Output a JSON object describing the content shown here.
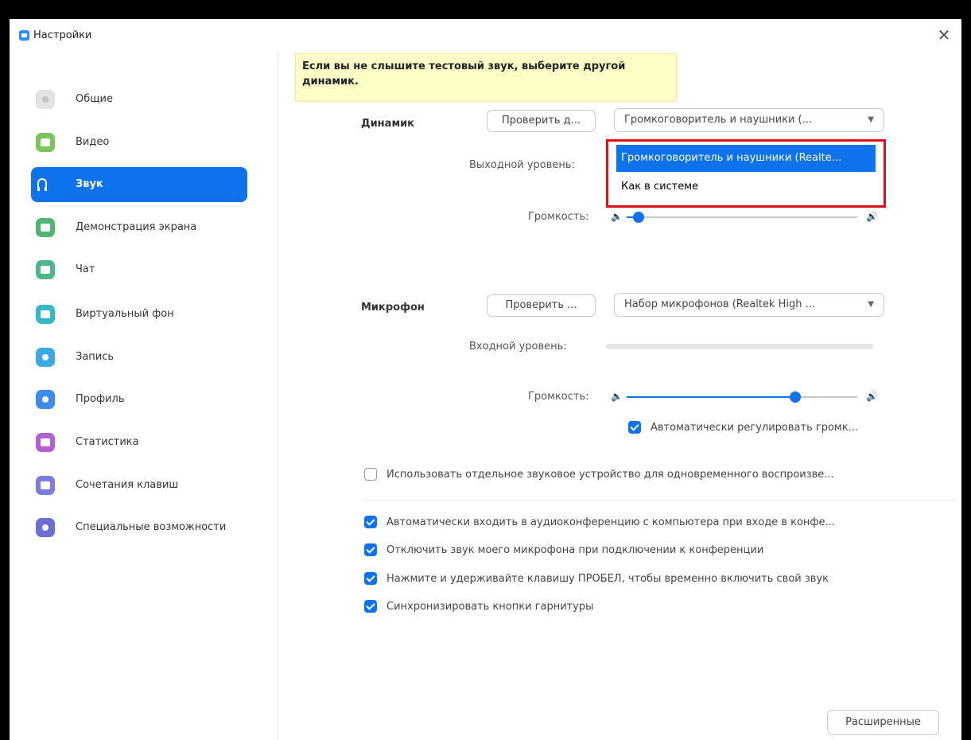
{
  "window": {
    "title": "Настройки"
  },
  "sidebar": {
    "items": [
      {
        "label": "Общие",
        "icon": "gear-icon",
        "color": "#d9d9d9",
        "active": false
      },
      {
        "label": "Видео",
        "icon": "video-camera-icon",
        "color": "#7cc35c",
        "active": false
      },
      {
        "label": "Звук",
        "icon": "headphones-icon",
        "color": "#0e72ed",
        "active": true
      },
      {
        "label": "Демонстрация экрана",
        "icon": "screen-share-icon",
        "color": "#4fb672",
        "active": false
      },
      {
        "label": "Чат",
        "icon": "chat-bubble-icon",
        "color": "#4fb68b",
        "active": false
      },
      {
        "label": "Виртуальный фон",
        "icon": "virtual-background-icon",
        "color": "#35b7c6",
        "active": false
      },
      {
        "label": "Запись",
        "icon": "record-icon",
        "color": "#3aa9e6",
        "active": false
      },
      {
        "label": "Профиль",
        "icon": "profile-icon",
        "color": "#3c8cf0",
        "active": false
      },
      {
        "label": "Статистика",
        "icon": "statistics-icon",
        "color": "#b260cf",
        "active": false
      },
      {
        "label": "Сочетания клавиш",
        "icon": "keyboard-icon",
        "color": "#7b7be0",
        "active": false
      },
      {
        "label": "Специальные возможности",
        "icon": "accessibility-icon",
        "color": "#6b6fd4",
        "active": false
      }
    ]
  },
  "notice": {
    "text": "Если вы не слышите тестовый звук, выберите другой динамик."
  },
  "speaker": {
    "label": "Динамик",
    "test_button": "Проверить д...",
    "selected": "Громкоговоритель и наушники (...",
    "options": [
      {
        "label": "Громкоговоритель и наушники (Realte...",
        "selected": true
      },
      {
        "label": "Как в системе",
        "selected": false
      }
    ],
    "output_level_label": "Выходной уровень:",
    "volume_label": "Громкость:",
    "volume": 0.05
  },
  "microphone": {
    "label": "Микрофон",
    "test_button": "Проверить ...",
    "selected": "Набор микрофонов (Realtek High ...",
    "input_level_label": "Входной уровень:",
    "volume_label": "Громкость:",
    "volume": 0.73,
    "auto_adjust": {
      "label": "Автоматически регулировать громк...",
      "checked": true
    }
  },
  "options": [
    {
      "label": "Использовать отдельное звуковое устройство для одновременного воспроизве...",
      "checked": false
    },
    {
      "label": "Автоматически входить в аудиоконференцию с компьютера при входе в конфе...",
      "checked": true
    },
    {
      "label": "Отключить звук моего микрофона при подключении к конференции",
      "checked": true
    },
    {
      "label": "Нажмите и удерживайте клавишу ПРОБЕЛ, чтобы временно включить свой звук",
      "checked": true
    },
    {
      "label": "Синхронизировать кнопки гарнитуры",
      "checked": true
    }
  ],
  "advanced_button": "Расширенные"
}
